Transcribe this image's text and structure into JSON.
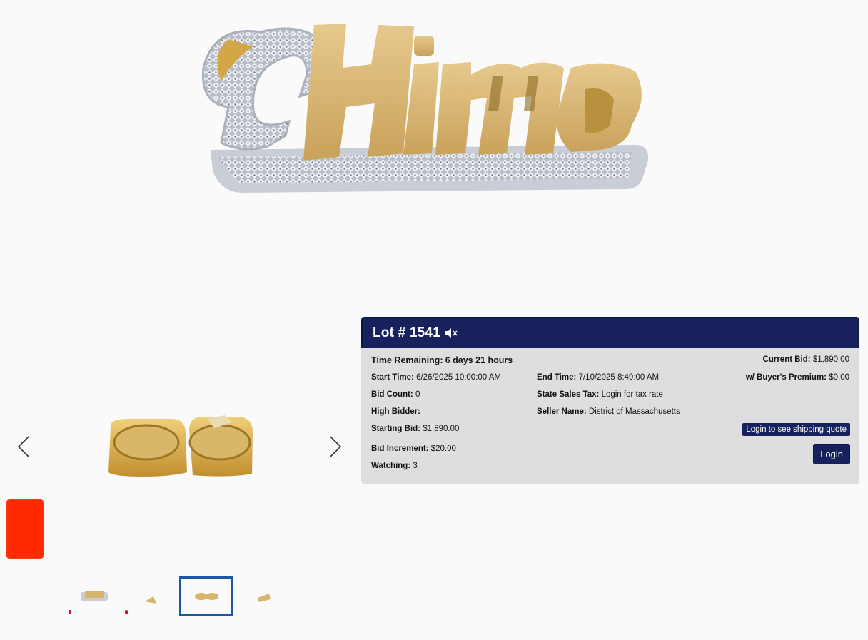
{
  "lot": {
    "title": "Lot # 1541",
    "mute_icon": "speaker-muted-icon"
  },
  "details": {
    "time_remaining_label": "Time Remaining:",
    "time_remaining_value": "6 days 21 hours",
    "current_bid_label": "Current Bid:",
    "current_bid_value": "$1,890.00",
    "start_time_label": "Start Time:",
    "start_time_value": "6/26/2025 10:00:00 AM",
    "end_time_label": "End Time:",
    "end_time_value": "7/10/2025 8:49:00 AM",
    "buyers_premium_label": "w/ Buyer's Premium:",
    "buyers_premium_value": "$0.00",
    "bid_count_label": "Bid Count:",
    "bid_count_value": "0",
    "state_tax_label": "State Sales Tax:",
    "state_tax_value": "Login for tax rate",
    "high_bidder_label": "High Bidder:",
    "high_bidder_value": "",
    "seller_name_label": "Seller Name:",
    "seller_name_value": "District of Massachusetts",
    "starting_bid_label": "Starting Bid:",
    "starting_bid_value": "$1,890.00",
    "bid_increment_label": "Bid Increment:",
    "bid_increment_value": "$20.00",
    "watching_label": "Watching:",
    "watching_value": "3"
  },
  "buttons": {
    "shipping_quote": "Login to see shipping quote",
    "login": "Login"
  },
  "carousel": {
    "prev_icon": "chevron-left-icon",
    "next_icon": "chevron-right-icon",
    "active_thumbnail_index": 2,
    "thumbnail_count": 4
  },
  "colors": {
    "header_bg": "#16215e",
    "panel_bg": "#dedede",
    "button_bg": "#16215e",
    "active_thumb_border": "#1c57a8",
    "swatch_red": "#ff2a00",
    "gold": "#d9b46a",
    "silver": "#c9ced6"
  }
}
